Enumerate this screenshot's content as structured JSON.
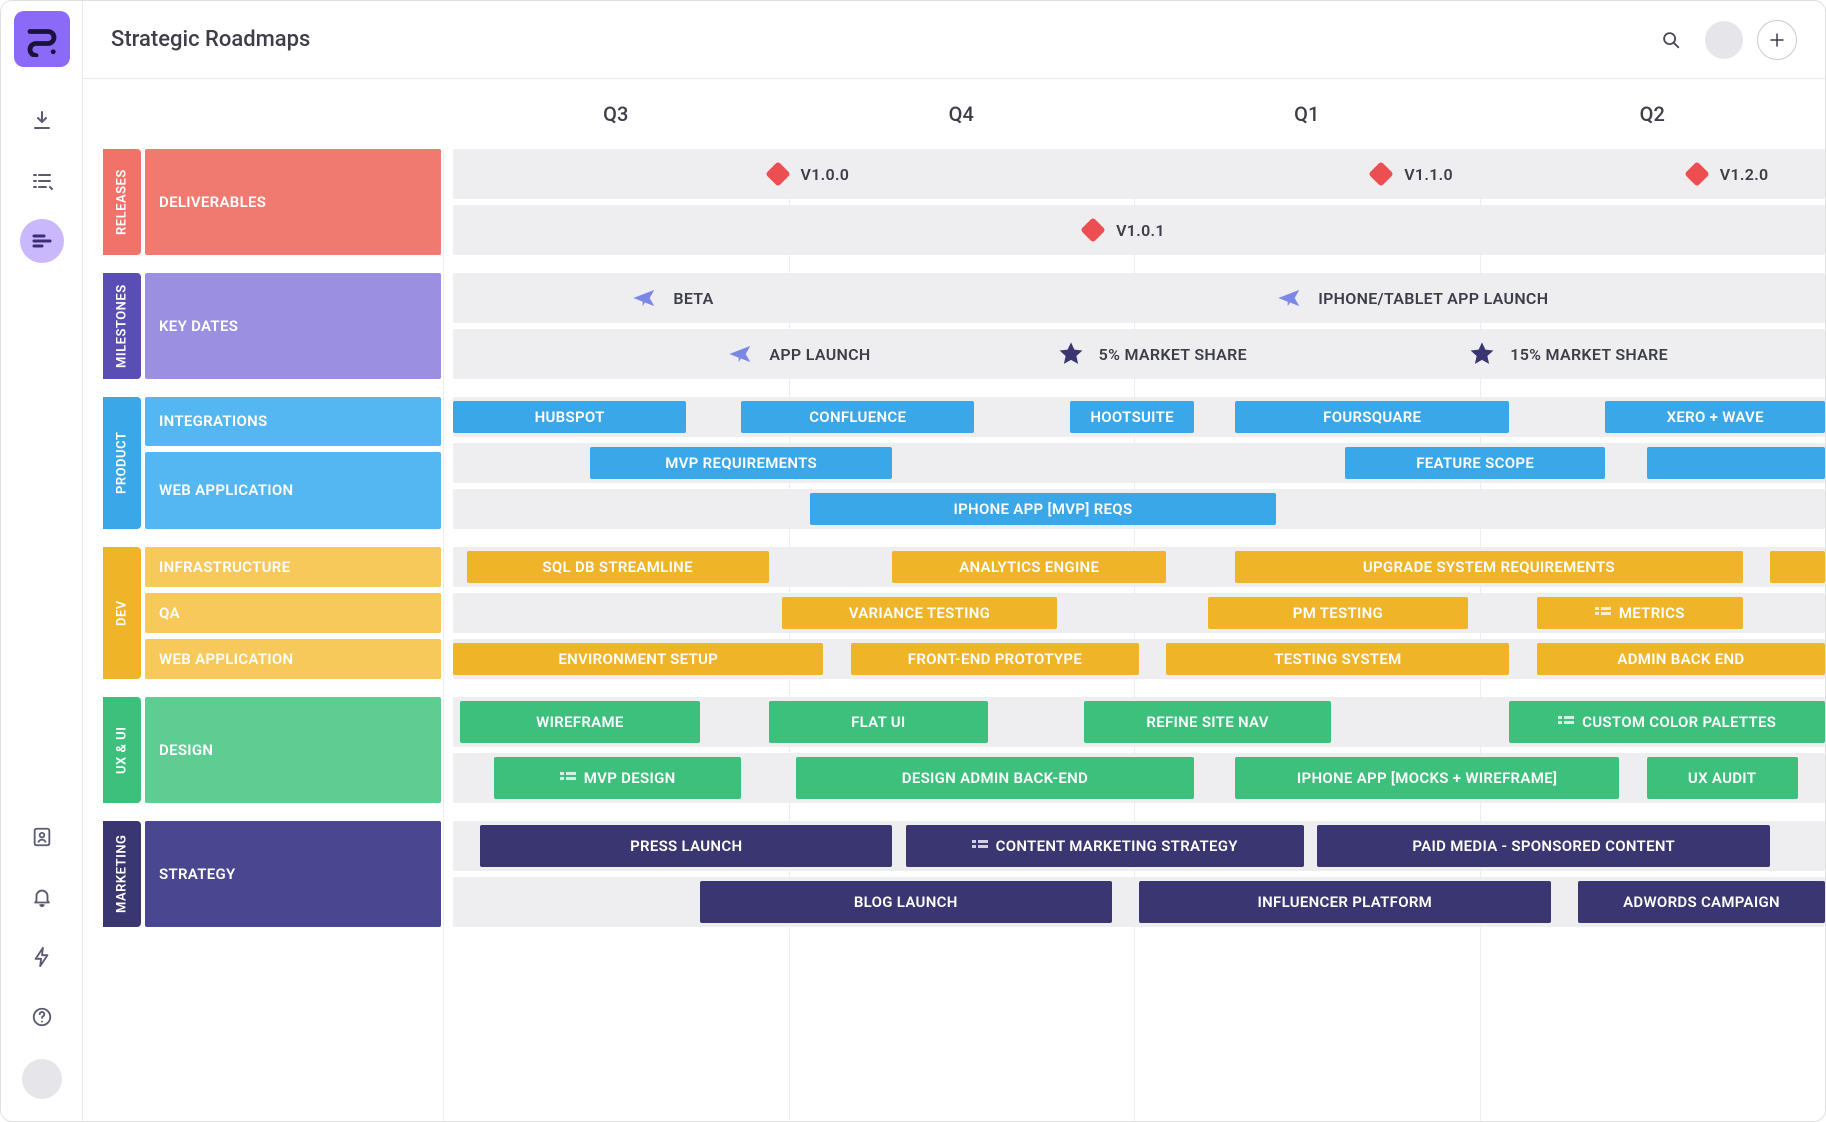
{
  "header": {
    "title": "Strategic Roadmaps"
  },
  "columns": [
    "Q3",
    "Q4",
    "Q1",
    "Q2"
  ],
  "colors": {
    "red": "#f07268",
    "purple": "#9a8fe0",
    "blue": "#3aa7e8",
    "yellow": "#f0b429",
    "green": "#3ec07d",
    "navy": "#3a3672",
    "diamond": "#ed4e52",
    "plane": "#7a87e6",
    "star": "#3a3672"
  },
  "swimlanes": [
    {
      "id": "releases",
      "tab": "RELEASES",
      "groups": [
        {
          "label": "DELIVERABLES",
          "rows": [
            {
              "markers": [
                {
                  "icon": "diamond",
                  "label": "V1.0.0",
                  "pos": 23
                },
                {
                  "icon": "diamond",
                  "label": "V1.1.0",
                  "pos": 67
                },
                {
                  "icon": "diamond",
                  "label": "V1.2.0",
                  "pos": 90
                }
              ]
            },
            {
              "markers": [
                {
                  "icon": "diamond",
                  "label": "V1.0.1",
                  "pos": 46
                }
              ]
            }
          ]
        }
      ]
    },
    {
      "id": "milestones",
      "tab": "MILESTONES",
      "groups": [
        {
          "label": "KEY DATES",
          "rows": [
            {
              "markers": [
                {
                  "icon": "plane",
                  "label": "BETA",
                  "pos": 13
                },
                {
                  "icon": "plane",
                  "label": "IPHONE/TABLET APP LAUNCH",
                  "pos": 60
                }
              ]
            },
            {
              "markers": [
                {
                  "icon": "plane",
                  "label": "APP LAUNCH",
                  "pos": 20
                },
                {
                  "icon": "star",
                  "label": "5% MARKET SHARE",
                  "pos": 44
                },
                {
                  "icon": "star",
                  "label": "15% MARKET SHARE",
                  "pos": 74
                }
              ]
            }
          ]
        }
      ]
    },
    {
      "id": "product",
      "tab": "PRODUCT",
      "groups": [
        {
          "label": "INTEGRATIONS",
          "rows": [
            {
              "bars": [
                {
                  "label": "HUBSPOT",
                  "start": 0,
                  "end": 17
                },
                {
                  "label": "CONFLUENCE",
                  "start": 21,
                  "end": 38
                },
                {
                  "label": "HOOTSUITE",
                  "start": 45,
                  "end": 54
                },
                {
                  "label": "FOURSQUARE",
                  "start": 57,
                  "end": 77
                },
                {
                  "label": "XERO + WAVE",
                  "start": 84,
                  "end": 100
                }
              ]
            }
          ]
        },
        {
          "label": "WEB APPLICATION",
          "rows": [
            {
              "bars": [
                {
                  "label": "MVP REQUIREMENTS",
                  "start": 10,
                  "end": 32
                },
                {
                  "label": "FEATURE SCOPE",
                  "start": 65,
                  "end": 84
                },
                {
                  "label": "",
                  "start": 87,
                  "end": 100
                }
              ]
            },
            {
              "bars": [
                {
                  "label": "IPHONE APP [MVP] REQS",
                  "start": 26,
                  "end": 60
                }
              ]
            }
          ]
        }
      ]
    },
    {
      "id": "dev",
      "tab": "DEV",
      "groups": [
        {
          "label": "INFRASTRUCTURE",
          "rows": [
            {
              "bars": [
                {
                  "label": "SQL DB STREAMLINE",
                  "start": 1,
                  "end": 23
                },
                {
                  "label": "ANALYTICS ENGINE",
                  "start": 32,
                  "end": 52
                },
                {
                  "label": "UPGRADE SYSTEM REQUIREMENTS",
                  "start": 57,
                  "end": 94
                },
                {
                  "label": "",
                  "start": 96,
                  "end": 100
                }
              ]
            }
          ]
        },
        {
          "label": "QA",
          "rows": [
            {
              "bars": [
                {
                  "label": "VARIANCE TESTING",
                  "start": 24,
                  "end": 44
                },
                {
                  "label": "PM TESTING",
                  "start": 55,
                  "end": 74
                },
                {
                  "label": "METRICS",
                  "start": 79,
                  "end": 94,
                  "icon": "list"
                }
              ]
            }
          ]
        },
        {
          "label": "WEB APPLICATION",
          "rows": [
            {
              "bars": [
                {
                  "label": "ENVIRONMENT SETUP",
                  "start": 0,
                  "end": 27
                },
                {
                  "label": "FRONT-END PROTOTYPE",
                  "start": 29,
                  "end": 50
                },
                {
                  "label": "TESTING SYSTEM",
                  "start": 52,
                  "end": 77
                },
                {
                  "label": "ADMIN BACK END",
                  "start": 79,
                  "end": 100
                }
              ]
            }
          ]
        }
      ]
    },
    {
      "id": "uxui",
      "tab": "UX & UI",
      "groups": [
        {
          "label": "DESIGN",
          "rows": [
            {
              "bars": [
                {
                  "label": "WIREFRAME",
                  "start": 0.5,
                  "end": 18
                },
                {
                  "label": "FLAT UI",
                  "start": 23,
                  "end": 39
                },
                {
                  "label": "REFINE SITE NAV",
                  "start": 46,
                  "end": 64
                },
                {
                  "label": "CUSTOM COLOR PALETTES",
                  "start": 77,
                  "end": 100,
                  "icon": "list"
                }
              ]
            },
            {
              "bars": [
                {
                  "label": "MVP DESIGN",
                  "start": 3,
                  "end": 21,
                  "icon": "list"
                },
                {
                  "label": "DESIGN ADMIN BACK-END",
                  "start": 25,
                  "end": 54
                },
                {
                  "label": "IPHONE APP [MOCKS + WIREFRAME]",
                  "start": 57,
                  "end": 85
                },
                {
                  "label": "UX AUDIT",
                  "start": 87,
                  "end": 98
                }
              ]
            }
          ]
        }
      ]
    },
    {
      "id": "marketing",
      "tab": "MARKETING",
      "groups": [
        {
          "label": "STRATEGY",
          "rows": [
            {
              "bars": [
                {
                  "label": "PRESS LAUNCH",
                  "start": 2,
                  "end": 32
                },
                {
                  "label": "CONTENT MARKETING STRATEGY",
                  "start": 33,
                  "end": 62,
                  "icon": "list"
                },
                {
                  "label": "PAID MEDIA - SPONSORED CONTENT",
                  "start": 63,
                  "end": 96
                }
              ]
            },
            {
              "bars": [
                {
                  "label": "BLOG LAUNCH",
                  "start": 18,
                  "end": 48
                },
                {
                  "label": "INFLUENCER PLATFORM",
                  "start": 50,
                  "end": 80
                },
                {
                  "label": "ADWORDS CAMPAIGN",
                  "start": 82,
                  "end": 100
                }
              ]
            }
          ]
        }
      ]
    }
  ],
  "lane_styles": {
    "releases": {
      "tab": "c-red",
      "group": "c-red-l",
      "bar": "c-red"
    },
    "milestones": {
      "tab": "c-purp",
      "group": "c-purp-l",
      "bar": "c-purp"
    },
    "product": {
      "tab": "c-blue-t",
      "group": "c-blue-l",
      "bar": "c-blue",
      "group_rows": [
        1,
        2
      ]
    },
    "dev": {
      "tab": "c-yel",
      "group": "c-yel-l",
      "bar": "c-yel"
    },
    "uxui": {
      "tab": "c-grn",
      "group": "c-grn-l",
      "bar": "c-grn"
    },
    "marketing": {
      "tab": "c-navy",
      "group": "c-navy-l",
      "bar": "c-navy"
    }
  }
}
